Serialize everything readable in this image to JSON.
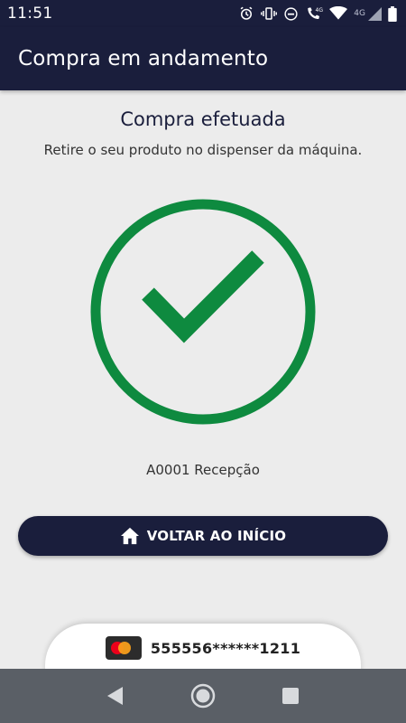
{
  "status_bar": {
    "time": "11:51",
    "network_label": "4G",
    "icons": [
      "alarm-icon",
      "vibrate-icon",
      "do-not-disturb-icon",
      "wifi-calling-icon",
      "wifi-icon",
      "signal-icon",
      "battery-icon"
    ]
  },
  "app_bar": {
    "title": "Compra em andamento"
  },
  "main": {
    "title": "Compra efetuada",
    "subtitle": "Retire o seu produto no dispenser da máquina.",
    "success_icon": "check-circle-icon",
    "location": "A0001 Recepção",
    "home_button_label": "VOLTAR AO INÍCIO",
    "home_button_icon": "home-icon"
  },
  "payment": {
    "card_brand_icon": "mastercard-icon",
    "card_number": "555556******1211"
  },
  "colors": {
    "primary": "#1a1e3c",
    "success": "#0e8a3f",
    "background": "#ececec",
    "nav_bar": "#5a5f66"
  },
  "nav_bar": {
    "buttons": [
      "back-icon",
      "home-circle-icon",
      "recents-icon"
    ]
  }
}
